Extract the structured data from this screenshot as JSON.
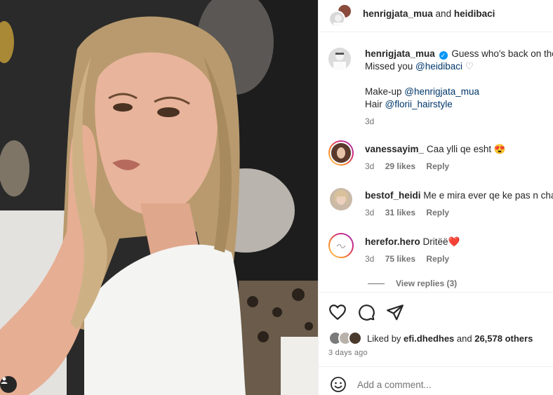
{
  "post": {
    "photo_alt": "Portrait photo of a blonde woman in a white t-shirt"
  },
  "header": {
    "user1": "henrigjata_mua",
    "joiner": "and",
    "user2": "heidibaci"
  },
  "caption": {
    "username": "henrigjata_mua",
    "line1": "Guess who's back on the",
    "line2_prefix": "Missed you ",
    "line2_mention": "@heidibaci",
    "line2_suffix": "♡",
    "line3_prefix": "Make-up ",
    "line3_mention": "@henrigjata_mua",
    "line4_prefix": "Hair ",
    "line4_mention": "@florii_hairstyle",
    "time": "3d"
  },
  "comments": [
    {
      "username": "vanessayim_",
      "text": "Caa ylli qe esht 😍",
      "time": "3d",
      "likes": "29 likes",
      "reply": "Reply"
    },
    {
      "username": "bestof_heidi",
      "text": "Me e mira ever qe ke pas n cha",
      "time": "3d",
      "likes": "31 likes",
      "reply": "Reply"
    },
    {
      "username": "herefor.hero",
      "text": "Dritëë❤️",
      "time": "3d",
      "likes": "75 likes",
      "reply": "Reply"
    }
  ],
  "view_replies": "View replies (3)",
  "likes": {
    "prefix": "Liked by ",
    "user": "efi.dhedhes",
    "middle": " and ",
    "count": "26,578 others"
  },
  "posted_ago": "3 days ago",
  "add_comment": {
    "placeholder": "Add a comment..."
  },
  "icons": {
    "like": "heart-icon",
    "comment": "comment-icon",
    "share": "share-icon",
    "emoji": "emoji-icon",
    "tag": "user-tag-icon"
  },
  "colors": {
    "link": "#00376b",
    "verified": "#0095f6",
    "muted": "#737373"
  }
}
